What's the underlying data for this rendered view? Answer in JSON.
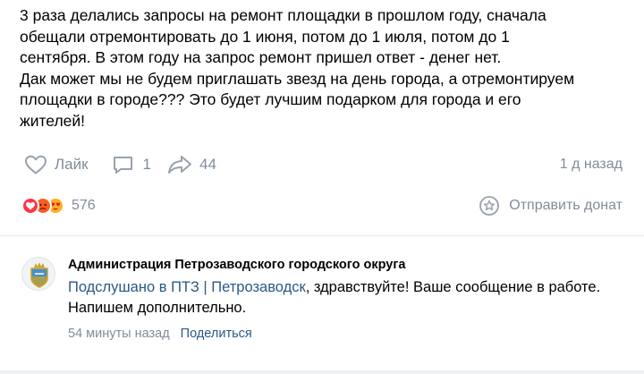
{
  "post": {
    "text_line1": "3 раза делались запросы на ремонт площадки в прошлом году, сначала",
    "text_line2": "обещали отремонтировать до 1 июня, потом до 1 июля, потом до 1",
    "text_line3": "сентября. В этом году на запрос ремонт пришел ответ - денег нет.",
    "text_line4": "Дак может мы не будем приглашать звезд на день города, а отремонтируем",
    "text_line5": "площадки в городе??? Это будет лучшим подарком для города и его",
    "text_line6": "жителей!"
  },
  "actions": {
    "like_label": "Лайк",
    "comments_count": "1",
    "shares_count": "44",
    "time": "1 д назад"
  },
  "reactions": {
    "count": "576",
    "icons": [
      "heart-reaction",
      "angry-reaction",
      "heart-eyes-reaction"
    ]
  },
  "donate": {
    "label": "Отправить донат"
  },
  "comment": {
    "author": "Администрация Петрозаводского городского округа",
    "mention": "Подслушано в ПТЗ | Петрозаводск",
    "text_after_mention": ", здравствуйте! Ваше сообщение в работе.",
    "text_line2": "Напишем дополнительно.",
    "time": "54 минуты назад",
    "share_label": "Поделиться"
  },
  "colors": {
    "secondary_text": "#818c99",
    "link": "#2a5885",
    "divider": "#e7e8ec"
  }
}
